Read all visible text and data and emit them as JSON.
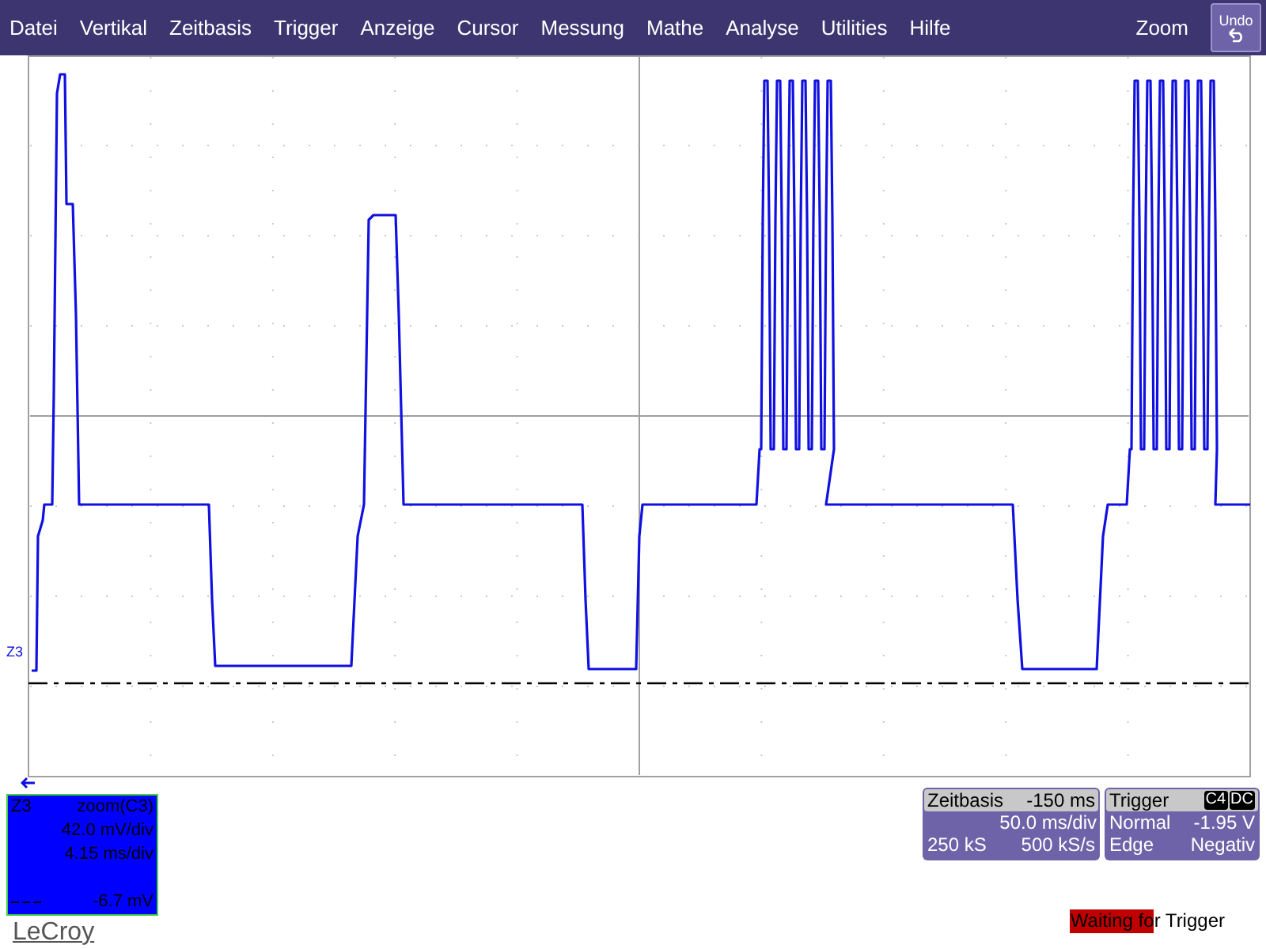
{
  "menu": [
    {
      "label": "Datei"
    },
    {
      "label": "Vertikal"
    },
    {
      "label": "Zeitbasis"
    },
    {
      "label": "Trigger"
    },
    {
      "label": "Anzeige"
    },
    {
      "label": "Cursor"
    },
    {
      "label": "Messung"
    },
    {
      "label": "Mathe"
    },
    {
      "label": "Analyse"
    },
    {
      "label": "Utilities"
    },
    {
      "label": "Hilfe"
    }
  ],
  "zoom_label": "Zoom",
  "undo_button": "Undo",
  "trace": {
    "label": "Z3"
  },
  "channel_box": {
    "name": "Z3",
    "source": "zoom(C3)",
    "vdiv": "42.0 mV/div",
    "tdiv": "4.15 ms/div",
    "offset": "-6.7 mV"
  },
  "logo": "LeCroy",
  "timebase": {
    "title": "Zeitbasis",
    "delay": "-150 ms",
    "tdiv": "50.0 ms/div",
    "samples": "250 kS",
    "rate": "500 kS/s"
  },
  "trigger": {
    "title": "Trigger",
    "badges": [
      "C4",
      "DC"
    ],
    "mode": "Normal",
    "level": "-1.95 V",
    "type": "Edge",
    "slope": "Negativ"
  },
  "status": "Waiting for Trigger"
}
